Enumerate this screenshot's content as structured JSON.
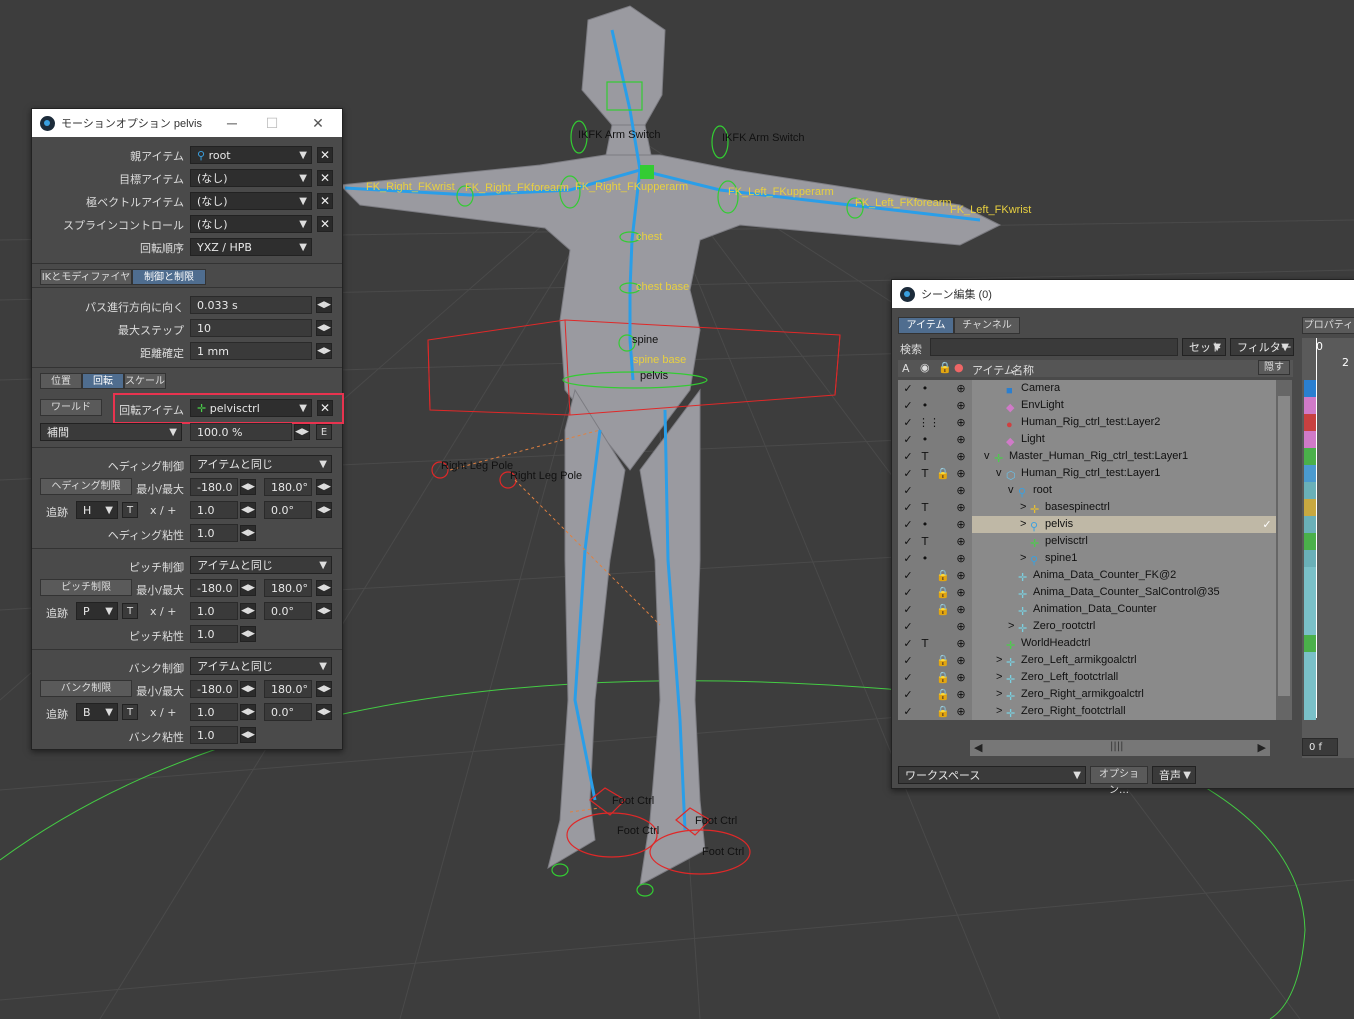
{
  "viewport": {
    "labels": {
      "ikfk_left": "IKFK Arm Switch",
      "ikfk_right": "IKFK Arm Switch",
      "right_fkwrist": "FK_Right_FKwrist",
      "right_fkforearm": "FK_Right_FKforearm",
      "right_fkupperarm": "FK_Right_FKupperarm",
      "left_fkupperarm": "FK_Left_FKupperarm",
      "left_fkforearm": "FK_Left_FKforearm",
      "left_fkwrist": "FK_Left_FKwrist",
      "chest": "chest",
      "chest_base": "chest base",
      "spine": "spine",
      "spine_base": "spine base",
      "pelvis": "pelvis",
      "right_leg_pole_1": "Right Leg Pole",
      "right_leg_pole_2": "Right Leg Pole",
      "foot_ctrl_1": "Foot Ctrl",
      "foot_ctrl_2": "Foot Ctrl",
      "foot_ctrl_3": "Foot Ctrl",
      "foot_ctrl_4": "Foot Ctrl"
    },
    "colors": {
      "bone": "#2a9ee8",
      "ctrl": "#33cc33",
      "label_yellow": "#e8d040",
      "bounds": "#e02828"
    }
  },
  "motion": {
    "title": "モーションオプション pelvis",
    "win_minimize": "─",
    "win_maximize": "☐",
    "win_close": "✕",
    "parent_label": "親アイテム",
    "parent_value": "root",
    "target_label": "目標アイテム",
    "target_value": "(なし)",
    "pole_label": "極ベクトルアイテム",
    "pole_value": "(なし)",
    "spline_label": "スプラインコントロール",
    "spline_value": "(なし)",
    "rotorder_label": "回転順序",
    "rotorder_value": "YXZ / HPB",
    "tab_ik": "IKとモディファイヤ",
    "tab_ctrl": "制御と制限",
    "path_label": "パス進行方向に向く",
    "path_value": "0.033 s",
    "maxstep_label": "最大ステップ",
    "maxstep_value": "10",
    "dist_label": "距離確定",
    "dist_value": "1 mm",
    "sub_pos": "位置",
    "sub_rot": "回転",
    "sub_scale": "スケール",
    "world_btn": "ワールド",
    "rotitem_label": "回転アイテム",
    "rotitem_value": "pelvisctrl",
    "blend_value": "補間",
    "blend_pct": "100.0 %",
    "e_btn": "E",
    "h_ctrl_label": "ヘディング制御",
    "h_ctrl_value": "アイテムと同じ",
    "h_limit_btn": "ヘディング制限",
    "minmax_label": "最小/最大",
    "h_min": "-180.0",
    "h_max": "180.0°",
    "track_label": "追跡",
    "h_axis": "H",
    "t_btn": "T",
    "xplus_label": "x / +",
    "h_mult": "1.0",
    "h_off": "0.0°",
    "h_stick_label": "ヘディング粘性",
    "h_stick": "1.0",
    "p_ctrl_label": "ピッチ制御",
    "p_ctrl_value": "アイテムと同じ",
    "p_limit_btn": "ピッチ制限",
    "p_min": "-180.0",
    "p_max": "180.0°",
    "p_axis": "P",
    "p_mult": "1.0",
    "p_off": "0.0°",
    "p_stick_label": "ピッチ粘性",
    "p_stick": "1.0",
    "b_ctrl_label": "バンク制御",
    "b_ctrl_value": "アイテムと同じ",
    "b_limit_btn": "バンク制限",
    "b_min": "-180.0",
    "b_max": "180.0°",
    "b_axis": "B",
    "b_mult": "1.0",
    "b_off": "0.0°",
    "b_stick_label": "バンク粘性",
    "b_stick": "1.0"
  },
  "scene": {
    "title": "シーン編集 (0)",
    "tab_items": "アイテム",
    "tab_channels": "チャンネル",
    "props_tab": "プロパティ",
    "search_label": "検索",
    "set_btn": "セット",
    "filter_btn": "フィルター",
    "col_a": "A",
    "col_items": "アイテム",
    "col_name": "名称",
    "hide_btn": "隠す",
    "workspace": "ワークスペース",
    "options_btn": "オプション…",
    "audio_btn": "音声",
    "frame_value": "0 f",
    "ruler_0": "0",
    "ruler_2": "2",
    "rows": [
      {
        "name": "Camera",
        "vis": "•",
        "lock": "",
        "icon": "camera",
        "expand": ""
      },
      {
        "name": "EnvLight",
        "vis": "•",
        "lock": "",
        "icon": "light",
        "expand": ""
      },
      {
        "name": "Human_Rig_ctrl_test:Layer2",
        "vis": "⋮⋮",
        "lock": "",
        "icon": "mesh",
        "expand": ""
      },
      {
        "name": "Light",
        "vis": "•",
        "lock": "",
        "icon": "light",
        "expand": ""
      },
      {
        "name": "Master_Human_Rig_ctrl_test:Layer1",
        "vis": "T",
        "lock": "",
        "icon": "null",
        "expand": "v"
      },
      {
        "name": "Human_Rig_ctrl_test:Layer1",
        "vis": "T",
        "lock": "🔒",
        "icon": "object",
        "expand": "v"
      },
      {
        "name": "root",
        "vis": "",
        "lock": "",
        "icon": "bone",
        "expand": "v"
      },
      {
        "name": "basespinectrl",
        "vis": "T",
        "lock": "",
        "icon": "nully",
        "expand": ">"
      },
      {
        "name": "pelvis",
        "vis": "•",
        "lock": "",
        "icon": "bone",
        "expand": ">",
        "selected": true
      },
      {
        "name": "pelvisctrl",
        "vis": "T",
        "lock": "",
        "icon": "null",
        "expand": ""
      },
      {
        "name": "spine1",
        "vis": "•",
        "lock": "",
        "icon": "bone",
        "expand": ">"
      },
      {
        "name": "Anima_Data_Counter_FK@2",
        "vis": "",
        "lock": "🔒",
        "icon": "nullc",
        "expand": ""
      },
      {
        "name": "Anima_Data_Counter_SalControl@35",
        "vis": "",
        "lock": "🔒",
        "icon": "nullc",
        "expand": ""
      },
      {
        "name": "Animation_Data_Counter",
        "vis": "",
        "lock": "🔒",
        "icon": "nullc",
        "expand": ""
      },
      {
        "name": "Zero_rootctrl",
        "vis": "",
        "lock": "",
        "icon": "nullc",
        "expand": ">"
      },
      {
        "name": "WorldHeadctrl",
        "vis": "T",
        "lock": "",
        "icon": "null",
        "expand": ""
      },
      {
        "name": "Zero_Left_armikgoalctrl",
        "vis": "",
        "lock": "🔒",
        "icon": "nullc",
        "expand": ">"
      },
      {
        "name": "Zero_Left_footctrlall",
        "vis": "",
        "lock": "🔒",
        "icon": "nullc",
        "expand": ">"
      },
      {
        "name": "Zero_Right_armikgoalctrl",
        "vis": "",
        "lock": "🔒",
        "icon": "nullc",
        "expand": ">"
      },
      {
        "name": "Zero_Right_footctrlall",
        "vis": "",
        "lock": "🔒",
        "icon": "nullc",
        "expand": ">"
      }
    ],
    "row_colors": [
      "#2a7fd0",
      "#d07ac8",
      "#c84040",
      "#d07ac8",
      "#4ab04a",
      "#4a9acf",
      "#6ab0b8",
      "#c8a840",
      "#6ab0b8",
      "#4ab04a",
      "#6ab0b8",
      "#7ac0c8",
      "#7ac0c8",
      "#7ac0c8",
      "#7ac0c8",
      "#4ab04a",
      "#7ac0c8",
      "#7ac0c8",
      "#7ac0c8",
      "#7ac0c8"
    ]
  }
}
